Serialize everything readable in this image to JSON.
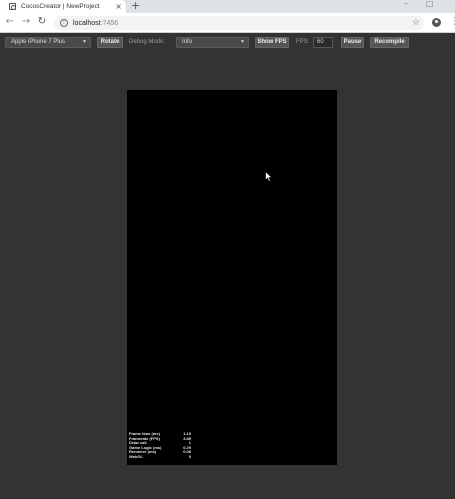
{
  "tab": {
    "title": "CocosCreator | NewProject",
    "close_glyph": "×",
    "new_tab_glyph": "+"
  },
  "window_controls": {
    "minimize": "–",
    "maximize": "□"
  },
  "address_bar": {
    "host": "localhost",
    "port": ":7456",
    "back_glyph": "←",
    "forward_glyph": "→",
    "reload_glyph": "↻",
    "info_glyph": "i",
    "star_glyph": "☆",
    "menu_glyph": "⋮"
  },
  "preview_toolbar": {
    "device_select": "Apple iPhone 7 Plus",
    "rotate_label": "Rotate",
    "debug_mode_label": "Debug Mode:",
    "debug_mode_select": "Info",
    "show_fps_label": "Show FPS",
    "fps_label": "FPS:",
    "fps_value": "60",
    "pause_label": "Pause",
    "recompile_label": "Recompile",
    "caret_glyph": "▼"
  },
  "stats": [
    {
      "label": "Frame time (ms)",
      "value": "1.10"
    },
    {
      "label": "Framerate (FPS)",
      "value": "3.85"
    },
    {
      "label": "Draw call",
      "value": "1"
    },
    {
      "label": "Game Logic (ms)",
      "value": "0.29"
    },
    {
      "label": "Renderer (ms)",
      "value": "0.08"
    },
    {
      "label": "WebGL",
      "value": "0"
    }
  ],
  "colors": {
    "page_bg": "#333333",
    "canvas_bg": "#000000",
    "tabstrip_bg": "#dee1e6"
  }
}
